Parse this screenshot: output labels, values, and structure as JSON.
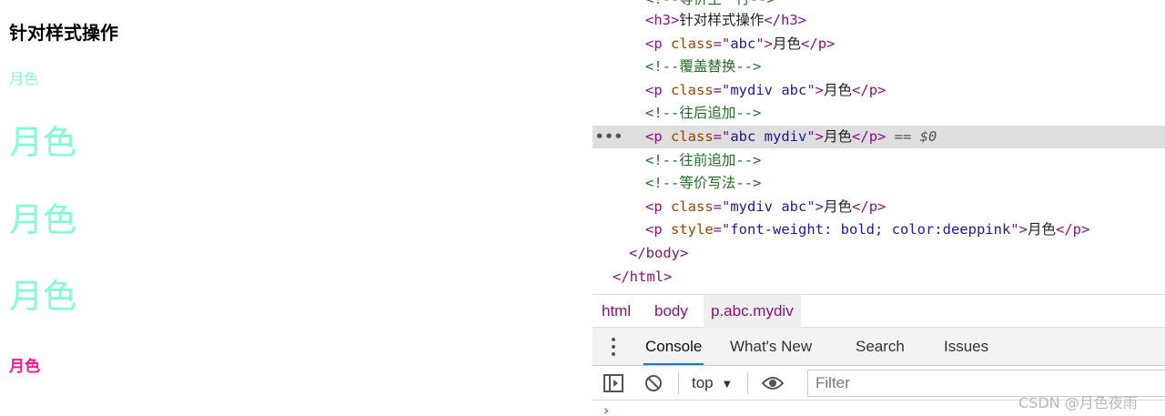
{
  "page": {
    "heading": "针对样式操作",
    "p1": "月色",
    "p2": "月色",
    "p3": "月色",
    "p4": "月色",
    "p5": "月色"
  },
  "elements_code": {
    "top_cut": "<!--等价生一行-->",
    "lines": [
      {
        "kind": "tag",
        "open": "<h3>",
        "text": "针对样式操作",
        "close": "</h3>"
      },
      {
        "kind": "p",
        "cls": "abc",
        "text": "月色"
      },
      {
        "kind": "comment",
        "text": "<!--覆盖替换-->"
      },
      {
        "kind": "p",
        "cls": "mydiv abc",
        "text": "月色"
      },
      {
        "kind": "comment",
        "text": "<!--往后追加-->"
      },
      {
        "kind": "p",
        "cls": "abc mydiv",
        "text": "月色",
        "selected": true,
        "suffix": "== $0"
      },
      {
        "kind": "comment",
        "text": "<!--往前追加-->"
      },
      {
        "kind": "comment",
        "text": "<!--等价写法-->"
      },
      {
        "kind": "p",
        "cls": "mydiv abc",
        "text": "月色"
      },
      {
        "kind": "pstyle",
        "style": "font-weight: bold; color:deeppink",
        "text": "月色"
      },
      {
        "kind": "close",
        "text": "</body>"
      },
      {
        "kind": "close",
        "text": "</html>"
      }
    ]
  },
  "breadcrumbs": [
    "html",
    "body",
    "p.abc.mydiv"
  ],
  "drawer_tabs": [
    "Console",
    "What's New",
    "Search",
    "Issues"
  ],
  "console": {
    "context": "top",
    "filter_placeholder": "Filter"
  },
  "watermark": "CSDN @月色夜雨",
  "icons": {
    "more": "more-dots-icon",
    "kebab": "kebab-menu-icon",
    "sidebar": "sidebar-toggle-icon",
    "clear": "clear-console-icon",
    "eye": "eye-icon",
    "caret": "caret-down-icon"
  },
  "colors": {
    "aquamarine": "#7fffd4",
    "deeppink": "#ff1493",
    "tag": "#881280",
    "attr": "#994500",
    "value": "#1a1aa6",
    "comment": "#236e25",
    "accent": "#1a73e8"
  }
}
